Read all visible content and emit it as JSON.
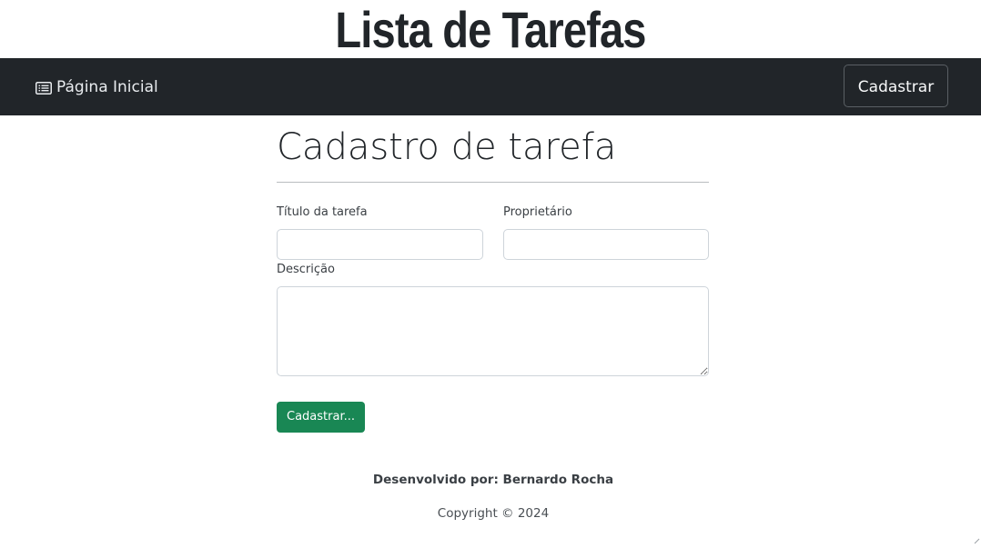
{
  "site": {
    "title": "Lista de Tarefas"
  },
  "navbar": {
    "home_label": "Página Inicial",
    "home_icon": "list-icon",
    "cadastrar_label": "Cadastrar"
  },
  "form": {
    "heading": "Cadastro de tarefa",
    "title_label": "Título da tarefa",
    "title_value": "",
    "owner_label": "Proprietário",
    "owner_value": "",
    "description_label": "Descrição",
    "description_value": "",
    "submit_label": "Cadastrar..."
  },
  "footer": {
    "developer": "Desenvolvido por: Bernardo Rocha",
    "copyright": "Copyright © 2024"
  },
  "colors": {
    "navbar_bg": "#212529",
    "submit_bg": "#198754"
  }
}
